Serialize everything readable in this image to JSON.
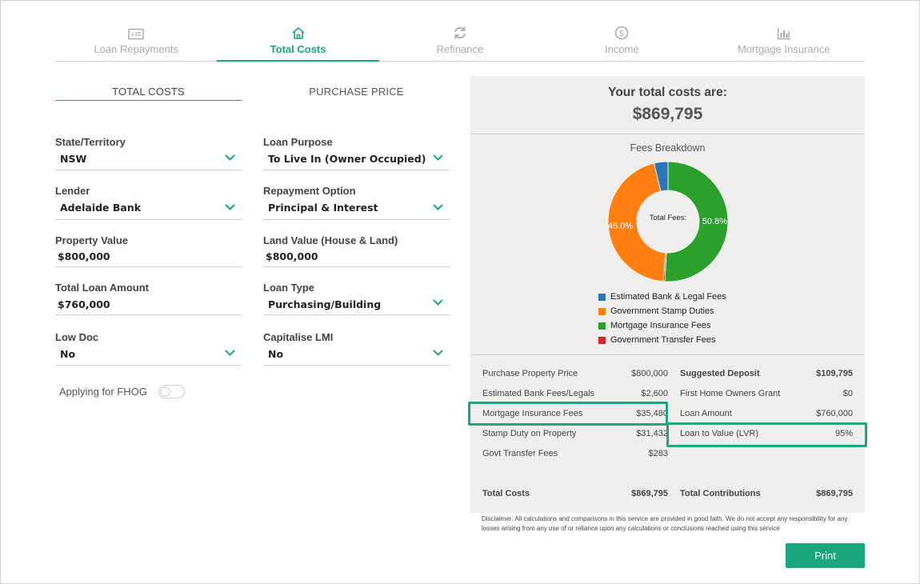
{
  "tabs": [
    {
      "label": "Loan Repayments",
      "icon": "money-note-icon",
      "active": false
    },
    {
      "label": "Total Costs",
      "icon": "home-icon",
      "active": true
    },
    {
      "label": "Refinance",
      "icon": "refresh-icon",
      "active": false
    },
    {
      "label": "Income",
      "icon": "dollar-circle-icon",
      "active": false
    },
    {
      "label": "Mortgage Insurance",
      "icon": "bar-chart-icon",
      "active": false
    }
  ],
  "subtabs": {
    "total_costs": "TOTAL COSTS",
    "purchase_price": "PURCHASE PRICE"
  },
  "left_fields": [
    {
      "label": "State/Territory",
      "value": "NSW",
      "dropdown": true
    },
    {
      "label": "Lender",
      "value": "Adelaide Bank",
      "dropdown": true
    },
    {
      "label": "Property Value",
      "value": "$800,000",
      "dropdown": false
    },
    {
      "label": "Total Loan Amount",
      "value": "$760,000",
      "dropdown": false
    },
    {
      "label": "Low Doc",
      "value": "No",
      "dropdown": true
    }
  ],
  "right_fields": [
    {
      "label": "Loan Purpose",
      "value": "To Live In (Owner Occupied)",
      "dropdown": true
    },
    {
      "label": "Repayment Option",
      "value": "Principal & Interest",
      "dropdown": true
    },
    {
      "label": "Land Value (House & Land)",
      "value": "$800,000",
      "dropdown": false
    },
    {
      "label": "Loan Type",
      "value": "Purchasing/Building",
      "dropdown": true
    },
    {
      "label": "Capitalise LMI",
      "value": "No",
      "dropdown": true
    }
  ],
  "fhog_label": "Applying for FHOG",
  "fhog_on": false,
  "summary": {
    "title": "Your total costs are:",
    "total": "$869,795"
  },
  "fees_title": "Fees Breakdown",
  "chart_data": {
    "type": "pie",
    "donut": true,
    "center_label": "Total Fees:",
    "slices": [
      {
        "label": "Estimated Bank & Legal Fees",
        "value": 2600,
        "color": "#2e75b6"
      },
      {
        "label": "Government Stamp Duties",
        "value": 31432,
        "color": "#ff8010",
        "data_label": "45.0%"
      },
      {
        "label": "Mortgage Insurance Fees",
        "value": 35480,
        "color": "#2ca02c",
        "data_label": "50.8%"
      },
      {
        "label": "Government Transfer Fees",
        "value": 283,
        "color": "#d62728"
      }
    ]
  },
  "costs": [
    {
      "label": "Purchase Property Price",
      "value": "$800,000"
    },
    {
      "label": "Estimated Bank Fees/Legals",
      "value": "$2,600"
    },
    {
      "label": "Mortgage Insurance Fees",
      "value": "$35,480"
    },
    {
      "label": "Stamp Duty on Property",
      "value": "$31,432"
    },
    {
      "label": "Govt Transfer Fees",
      "value": "$283"
    }
  ],
  "costs_total": {
    "label": "Total Costs",
    "value": "$869,795"
  },
  "contributions": [
    {
      "label": "Suggested Deposit",
      "value": "$109,795"
    },
    {
      "label": "First Home Owners Grant",
      "value": "$0"
    },
    {
      "label": "Loan Amount",
      "value": "$760,000"
    },
    {
      "label": "Loan to Value (LVR)",
      "value": "95%"
    }
  ],
  "contributions_total": {
    "label": "Total Contributions",
    "value": "$869,795"
  },
  "disclaimer": "Disclaimer: All calculations and comparisons in this service are provided in good faith. We do not accept any responsibility for any losses arising from any use of or reliance upon any calculations or conclusions reached using this service",
  "print_label": "Print",
  "colors": {
    "accent": "#1aa77d",
    "panel_bg": "#efeeec"
  }
}
